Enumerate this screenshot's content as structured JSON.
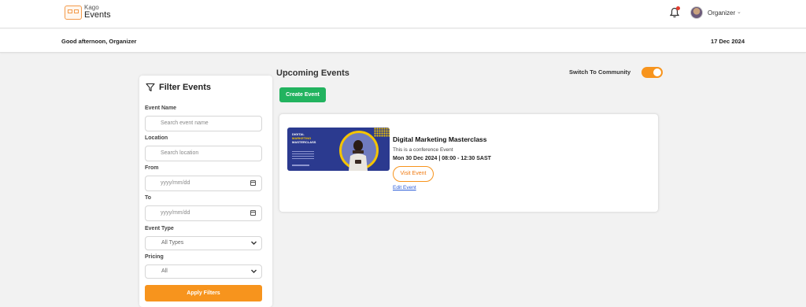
{
  "header": {
    "logo_small": "Kago",
    "logo_big": "Events",
    "user_name": "Organizer",
    "user_caret": "⌄"
  },
  "greeting_bar": {
    "greeting": "Good afternoon, Organizer",
    "date": "17 Dec 2024"
  },
  "filters": {
    "title": "Filter Events",
    "event_name_label": "Event Name",
    "event_name_placeholder": "Search event name",
    "location_label": "Location",
    "location_placeholder": "Search location",
    "from_label": "From",
    "from_placeholder": "yyyy/mm/dd",
    "to_label": "To",
    "to_placeholder": "yyyy/mm/dd",
    "event_type_label": "Event Type",
    "event_type_value": "All Types",
    "pricing_label": "Pricing",
    "pricing_value": "All",
    "apply_label": "Apply Filters"
  },
  "main": {
    "section_title": "Upcoming Events",
    "community_label": "Switch To Community",
    "community_toggle_on": true,
    "create_label": "Create Event"
  },
  "events": [
    {
      "banner_line1": "DIGITAL",
      "banner_line2": "MARKETING",
      "banner_line3": "MASTERCLASS",
      "title": "Digital Marketing Masterclass",
      "description": "This is a conference Event",
      "datetime": "Mon 30 Dec 2024 | 08:00 - 12:30 SAST",
      "visit_label": "Visit Event",
      "edit_label": "Edit Event"
    }
  ],
  "colors": {
    "accent": "#f7941d",
    "create_button": "#22b35f",
    "link": "#2a5bd7",
    "banner": "#2b3a8f",
    "banner_highlight": "#f4c400"
  },
  "icons": [
    "logo-icon",
    "bell-icon",
    "avatar",
    "funnel-icon",
    "calendar-icon",
    "chevron-down-icon"
  ]
}
